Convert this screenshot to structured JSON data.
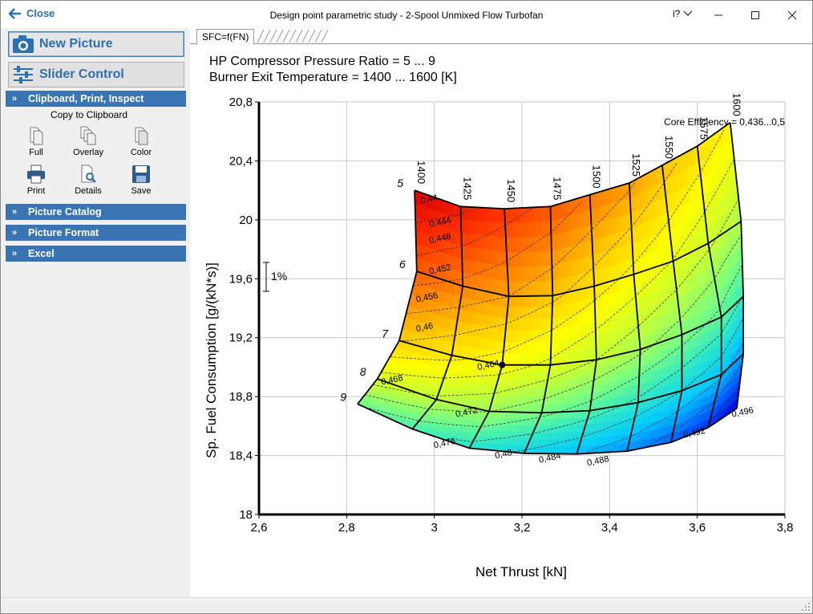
{
  "window": {
    "close_label": "Close",
    "title": "Design point parametric study - 2-Spool Unmixed Flow Turbofan",
    "help_label": "i?",
    "minimize_glyph": "—",
    "maximize_glyph": "☐",
    "close_glyph": "✕"
  },
  "sidebar": {
    "new_picture_label": "New Picture",
    "slider_control_label": "Slider Control",
    "sections": [
      {
        "label": "Clipboard, Print, Inspect",
        "expanded": true
      },
      {
        "label": "Picture Catalog",
        "expanded": false
      },
      {
        "label": "Picture Format",
        "expanded": false
      },
      {
        "label": "Excel",
        "expanded": false
      }
    ],
    "clipboard_title": "Copy to Clipboard",
    "clip_items": [
      "Full",
      "Overlay",
      "Color",
      "Print",
      "Details",
      "Save"
    ]
  },
  "tab": {
    "label": "SFC=f(FN)"
  },
  "plot": {
    "line1": "HP Compressor Pressure Ratio = 5 ... 9",
    "line2": "Burner Exit Temperature = 1400 ... 1600 [K]",
    "legend_text": "Core Efficiency = 0,436...0,5",
    "scale_marker": "1%"
  },
  "chart_data": {
    "type": "heatmap",
    "xlabel": "Net Thrust [kN]",
    "ylabel": "Sp. Fuel Consumption [g/(kN*s)]",
    "xlim": [
      2.6,
      3.8
    ],
    "ylim": [
      18,
      20.8
    ],
    "x_ticks": [
      "2,6",
      "2,8",
      "3",
      "3,2",
      "3,4",
      "3,6",
      "3,8"
    ],
    "y_ticks": [
      "18",
      "18,4",
      "18,8",
      "19,2",
      "19,6",
      "20",
      "20,4",
      "20,8"
    ],
    "grid": true,
    "colormap": [
      "#0000dc",
      "#0064ff",
      "#00c8ff",
      "#2ee8c8",
      "#7dff7d",
      "#c8ff32",
      "#ffff00",
      "#ffc800",
      "#ff7d00",
      "#ff3200",
      "#dc0000"
    ],
    "burner_temperatures": [
      "1400",
      "1425",
      "1450",
      "1475",
      "1500",
      "1525",
      "1550",
      "1575",
      "1600"
    ],
    "pressure_ratios": [
      "5",
      "6",
      "7",
      "8",
      "9"
    ],
    "grid_points_fn": [
      [
        2.955,
        3.06,
        3.16,
        3.265,
        3.355,
        3.445,
        3.52,
        3.6,
        3.675
      ],
      [
        2.96,
        3.065,
        3.17,
        3.27,
        3.365,
        3.455,
        3.545,
        3.625,
        3.7
      ],
      [
        2.92,
        3.04,
        3.155,
        3.265,
        3.37,
        3.47,
        3.565,
        3.655,
        3.705
      ],
      [
        2.87,
        3.005,
        3.125,
        3.245,
        3.355,
        3.465,
        3.565,
        3.655,
        3.705
      ],
      [
        2.825,
        2.95,
        3.08,
        3.205,
        3.325,
        3.44,
        3.54,
        3.625,
        3.69
      ]
    ],
    "grid_points_sfc": [
      [
        20.2,
        20.09,
        20.075,
        20.09,
        20.17,
        20.25,
        20.37,
        20.5,
        20.66
      ],
      [
        19.65,
        19.55,
        19.48,
        19.485,
        19.55,
        19.63,
        19.72,
        19.84,
        19.99
      ],
      [
        19.18,
        19.08,
        19.015,
        19.015,
        19.05,
        19.12,
        19.22,
        19.34,
        19.48
      ],
      [
        18.92,
        18.78,
        18.7,
        18.69,
        18.705,
        18.76,
        18.84,
        18.95,
        19.09
      ],
      [
        18.75,
        18.58,
        18.45,
        18.415,
        18.41,
        18.43,
        18.49,
        18.59,
        18.72
      ]
    ],
    "design_point": {
      "fn": 3.155,
      "sfc": 19.015
    },
    "efficiency_labels": [
      {
        "text": "0,44",
        "fn": 2.97,
        "sfc": 20.11
      },
      {
        "text": "0,444",
        "fn": 2.99,
        "sfc": 19.95
      },
      {
        "text": "0,448",
        "fn": 2.99,
        "sfc": 19.84
      },
      {
        "text": "0,452",
        "fn": 2.99,
        "sfc": 19.63
      },
      {
        "text": "0,456",
        "fn": 2.96,
        "sfc": 19.44
      },
      {
        "text": "0,46",
        "fn": 2.96,
        "sfc": 19.24
      },
      {
        "text": "0,464",
        "fn": 3.1,
        "sfc": 18.98
      },
      {
        "text": "0,468",
        "fn": 2.88,
        "sfc": 18.88
      },
      {
        "text": "0,472",
        "fn": 3.05,
        "sfc": 18.66
      },
      {
        "text": "0,476",
        "fn": 3.0,
        "sfc": 18.45
      },
      {
        "text": "0,48",
        "fn": 3.14,
        "sfc": 18.38
      },
      {
        "text": "0,484",
        "fn": 3.24,
        "sfc": 18.35
      },
      {
        "text": "0,488",
        "fn": 3.35,
        "sfc": 18.33
      },
      {
        "text": "0,492",
        "fn": 3.57,
        "sfc": 18.52
      },
      {
        "text": "0,496",
        "fn": 3.68,
        "sfc": 18.66
      }
    ]
  },
  "colors": {
    "accent": "#2e6fad",
    "section_header": "#3a74b3",
    "sidebar_bg": "#f0f0f0"
  }
}
